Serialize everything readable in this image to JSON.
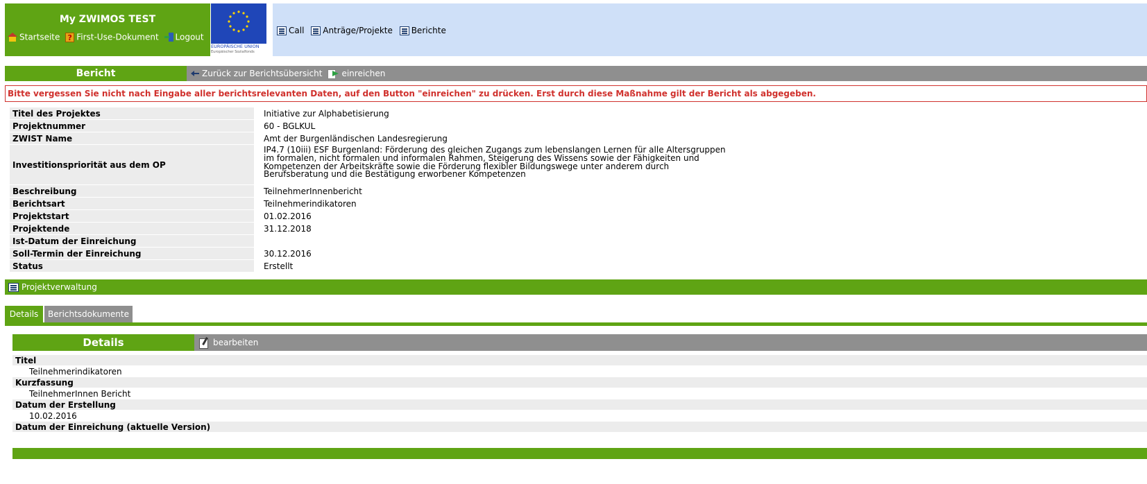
{
  "header": {
    "app_title": "My ZWIMOS TEST",
    "nav": [
      {
        "label": "Startseite",
        "icon": "home-icon"
      },
      {
        "label": "First-Use-Dokument",
        "icon": "help-icon"
      },
      {
        "label": "Logout",
        "icon": "logout-icon"
      }
    ],
    "eu_logo": {
      "line1": "EUROPÄISCHE UNION",
      "line2": "Europäischer Sozialfonds"
    },
    "menu": [
      {
        "label": "Call",
        "icon": "list-icon"
      },
      {
        "label": "Anträge/Projekte",
        "icon": "list-icon"
      },
      {
        "label": "Berichte",
        "icon": "list-icon"
      }
    ]
  },
  "report_bar": {
    "title": "Bericht",
    "back_label": "Zurück zur Berichtsübersicht",
    "submit_label": "einreichen"
  },
  "warning": "Bitte vergessen Sie nicht nach Eingabe aller berichtsrelevanten Daten, auf den Button \"einreichen\" zu drücken. Erst durch diese Maßnahme gilt der Bericht als abgegeben.",
  "info_rows": [
    {
      "label": "Titel des Projektes",
      "value": "Initiative zur Alphabetisierung"
    },
    {
      "label": "Projektnummer",
      "value": "60 - BGLKUL"
    },
    {
      "label": "ZWIST Name",
      "value": "Amt der Burgenländischen Landesregierung"
    },
    {
      "label": "Investitionspriorität aus dem OP",
      "value_lines": [
        "IP4.7 (10iii) ESF Burgenland: Förderung des gleichen Zugangs zum lebenslangen Lernen für alle Altersgruppen",
        "im formalen, nicht formalen und informalen Rahmen, Steigerung des Wissens sowie der Fähigkeiten und",
        "Kompetenzen der Arbeitskräfte sowie die Förderung flexibler Bildungswege unter anderem durch",
        "Berufsberatung und die Bestätigung erworbener Kompetenzen"
      ]
    },
    {
      "label": "Beschreibung",
      "value": "TeilnehmerInnenbericht"
    },
    {
      "label": "Berichtsart",
      "value": "Teilnehmerindikatoren"
    },
    {
      "label": "Projektstart",
      "value": "01.02.2016"
    },
    {
      "label": "Projektende",
      "value": "31.12.2018"
    },
    {
      "label": "Ist-Datum der Einreichung",
      "value": ""
    },
    {
      "label": "Soll-Termin der Einreichung",
      "value": "30.12.2016"
    },
    {
      "label": "Status",
      "value": "Erstellt"
    }
  ],
  "project_bar": {
    "label": "Projektverwaltung"
  },
  "tabs": [
    {
      "label": "Details",
      "active": true
    },
    {
      "label": "Berichtsdokumente",
      "active": false
    }
  ],
  "details": {
    "title": "Details",
    "edit_label": "bearbeiten",
    "fields": [
      {
        "label": "Titel",
        "value": "Teilnehmerindikatoren"
      },
      {
        "label": "Kurzfassung",
        "value": "TeilnehmerInnen Bericht"
      },
      {
        "label": "Datum der Erstellung",
        "value": "10.02.2016"
      },
      {
        "label": "Datum der Einreichung (aktuelle Version)",
        "value": ""
      }
    ]
  },
  "colors": {
    "green": "#5fa414",
    "gray_bar": "#8f8f8f",
    "header_blue": "#cfe0f8",
    "warning_red": "#d0312d",
    "row_gray": "#ececec"
  }
}
